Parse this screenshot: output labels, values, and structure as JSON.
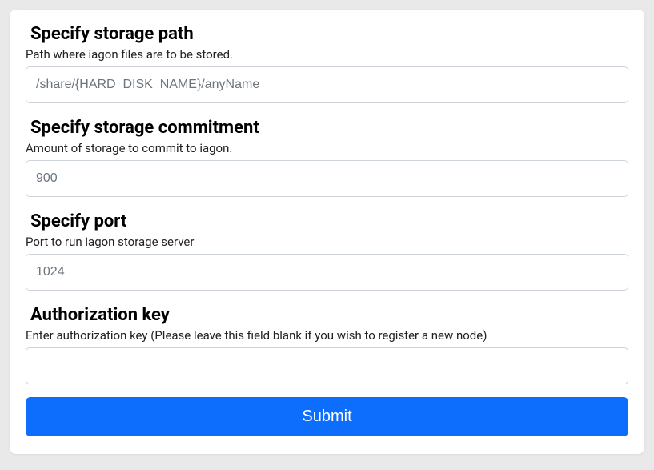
{
  "form": {
    "storage_path": {
      "title": "Specify storage path",
      "description": "Path where iagon files are to be stored.",
      "placeholder": "/share/{HARD_DISK_NAME}/anyName",
      "value": ""
    },
    "storage_commitment": {
      "title": "Specify storage commitment",
      "description": "Amount of storage to commit to iagon.",
      "placeholder": "900",
      "value": ""
    },
    "port": {
      "title": "Specify port",
      "description": "Port to run iagon storage server",
      "placeholder": "1024",
      "value": ""
    },
    "auth_key": {
      "title": "Authorization key",
      "description": "Enter authorization key (Please leave this field blank if you wish to register a new node)",
      "placeholder": "",
      "value": ""
    },
    "submit_label": "Submit"
  }
}
